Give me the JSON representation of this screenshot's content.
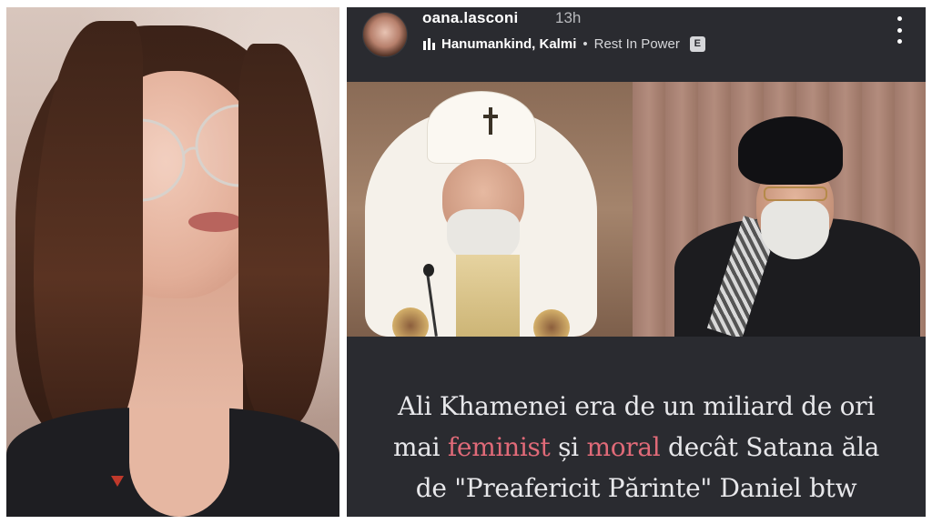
{
  "story": {
    "username": "oana.lasconi",
    "timestamp": "13h",
    "music": {
      "artists": "Hanumankind, Kalmi",
      "separator": "•",
      "track": "Rest In Power",
      "explicit_badge": "E"
    },
    "caption": {
      "line1": "Ali Khamenei era de un miliard de ori",
      "line2_prefix": "mai ",
      "line2_highlight1": "feminist",
      "line2_mid": " și ",
      "line2_highlight2": "moral",
      "line2_suffix": " decât Satana ăla",
      "line3": "de \"Preafericit Părinte\" Daniel btw"
    }
  },
  "colors": {
    "story_background": "#2a2b30",
    "caption_text": "#e7e7ea",
    "highlight": "#e06a78"
  },
  "icons": [
    "more-options-icon",
    "music-bars-icon",
    "explicit-icon",
    "avatar"
  ]
}
